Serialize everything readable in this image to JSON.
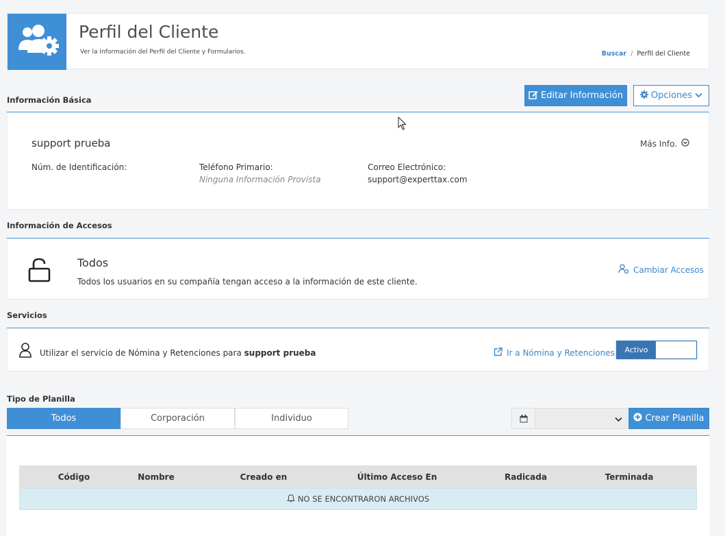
{
  "header": {
    "title": "Perfil del Cliente",
    "subtitle": "Ver la Información del Perfil del Cliente y Formularios.",
    "breadcrumb": {
      "link": "Buscar",
      "separator": "/",
      "current": "Perfil del Cliente"
    },
    "icon": "users-gear-icon",
    "accent_color": "#3f8fd6"
  },
  "basic_info": {
    "section_label": "Información Básica",
    "edit_button": "Editar Información",
    "options_button": "Opciones",
    "client_name": "support prueba",
    "more_info": "Más Info.",
    "fields": {
      "id_label": "Núm. de Identificación:",
      "phone_label": "Teléfono Primario:",
      "phone_value": "Ninguna Información Provista",
      "email_label": "Correo Electrónico:",
      "email_value": "support@experttax.com"
    }
  },
  "access": {
    "section_label": "Información de Accesos",
    "level": "Todos",
    "description": "Todos los usuarios en su compañía tengan acceso a la información de este cliente.",
    "change_link": "Cambiar Accesos",
    "icon": "unlock-icon"
  },
  "services": {
    "section_label": "Servicios",
    "text_prefix": "Utilizar el servicio de Nómina y Retenciones para",
    "client_bold": "support prueba",
    "go_link": "Ir a Nómina y Retenciones",
    "toggle_label": "Activo",
    "toggle_on": true
  },
  "forms": {
    "section_label": "Tipo de Planilla",
    "tabs": [
      "Todos",
      "Corporación",
      "Individuo"
    ],
    "active_tab": "Todos",
    "create_button": "Crear Planilla",
    "table_headers": [
      "Código",
      "Nombre",
      "Creado en",
      "Último Acceso En",
      "Radicada",
      "Terminada"
    ],
    "empty_message": "NO SE ENCONTRARON ARCHIVOS"
  }
}
